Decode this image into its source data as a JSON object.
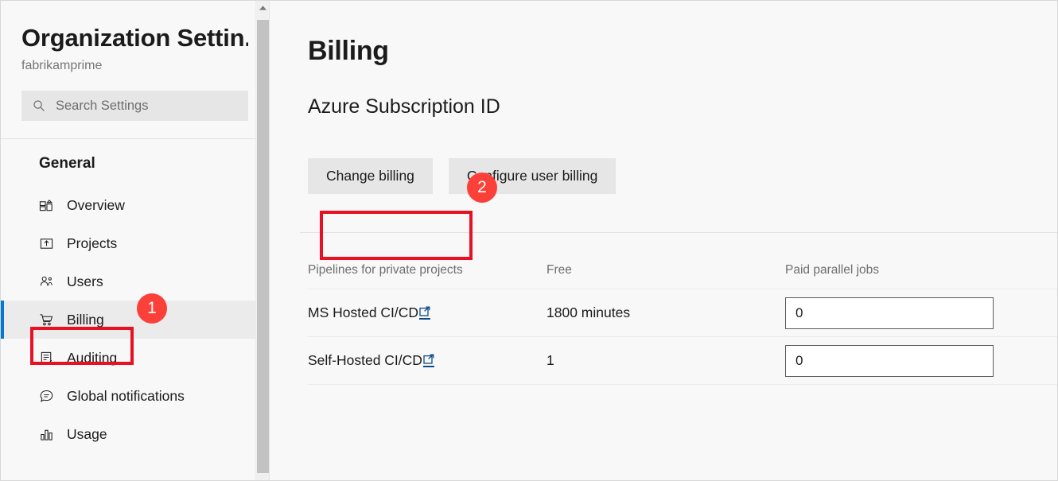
{
  "sidebar": {
    "org_title": "Organization Settin...",
    "org_name": "fabrikamprime",
    "search": {
      "placeholder": "Search Settings",
      "icon": "search-icon"
    },
    "section_label": "General",
    "items": [
      {
        "label": "Overview",
        "icon": "dashboard-icon",
        "selected": false
      },
      {
        "label": "Projects",
        "icon": "project-upload-icon",
        "selected": false
      },
      {
        "label": "Users",
        "icon": "users-icon",
        "selected": false
      },
      {
        "label": "Billing",
        "icon": "cart-icon",
        "selected": true
      },
      {
        "label": "Auditing",
        "icon": "clipboard-check-icon",
        "selected": false
      },
      {
        "label": "Global notifications",
        "icon": "speech-bubble-icon",
        "selected": false
      },
      {
        "label": "Usage",
        "icon": "bar-chart-icon",
        "selected": false
      }
    ],
    "scrollbar": {
      "up_arrow_icon": "chevron-up-icon"
    }
  },
  "main": {
    "page_title": "Billing",
    "section_title": "Azure Subscription ID",
    "buttons": {
      "change_billing": "Change billing",
      "configure_user_billing": "Configure user billing"
    },
    "table": {
      "headers": [
        "Pipelines for private projects",
        "Free",
        "Paid parallel jobs"
      ],
      "rows": [
        {
          "name": "MS Hosted CI/CD",
          "link_icon": "external-link-icon",
          "free": "1800 minutes",
          "paid": "0"
        },
        {
          "name": "Self-Hosted CI/CD",
          "link_icon": "external-link-icon",
          "free": "1",
          "paid": "0"
        }
      ]
    }
  },
  "annotations": {
    "badge_1": "1",
    "badge_2": "2",
    "highlight_color": "#e81123",
    "badge_color": "#fb4039"
  },
  "theme": {
    "accent": "#0078d4",
    "link": "#0d4a86",
    "page_bg": "#f8f8f8",
    "selected_bg": "#ebebeb"
  }
}
